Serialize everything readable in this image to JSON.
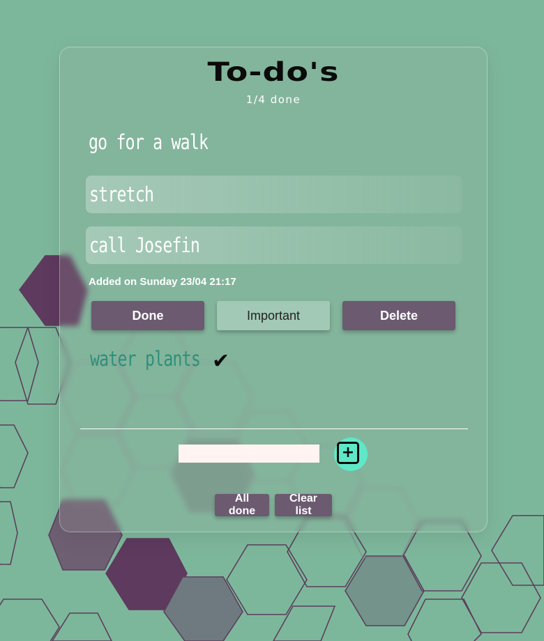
{
  "header": {
    "title": "To-do's",
    "progress_text": "1/4 done"
  },
  "tasks": [
    {
      "text": "go for a walk",
      "style": "plain"
    },
    {
      "text": "stretch",
      "style": "highlighted"
    },
    {
      "text": "call Josefin",
      "style": "selected"
    },
    {
      "text": "water plants",
      "style": "done",
      "done_mark": "✔"
    }
  ],
  "selected_task": {
    "added_text": "Added on Sunday 23/04 21:17",
    "actions": {
      "done_label": "Done",
      "important_label": "Important",
      "delete_label": "Delete"
    }
  },
  "new_task": {
    "input_value": "",
    "add_icon": "plus-square-icon"
  },
  "footer": {
    "all_done_label": "All done",
    "clear_list_label": "Clear list"
  },
  "colors": {
    "background": "#7db79b",
    "button_purple": "#6b5a70",
    "button_green": "#a2c9b6",
    "done_text": "#2e8f7a",
    "add_accent": "#5fe8c8",
    "hex_purple": "#5e3a5e"
  }
}
